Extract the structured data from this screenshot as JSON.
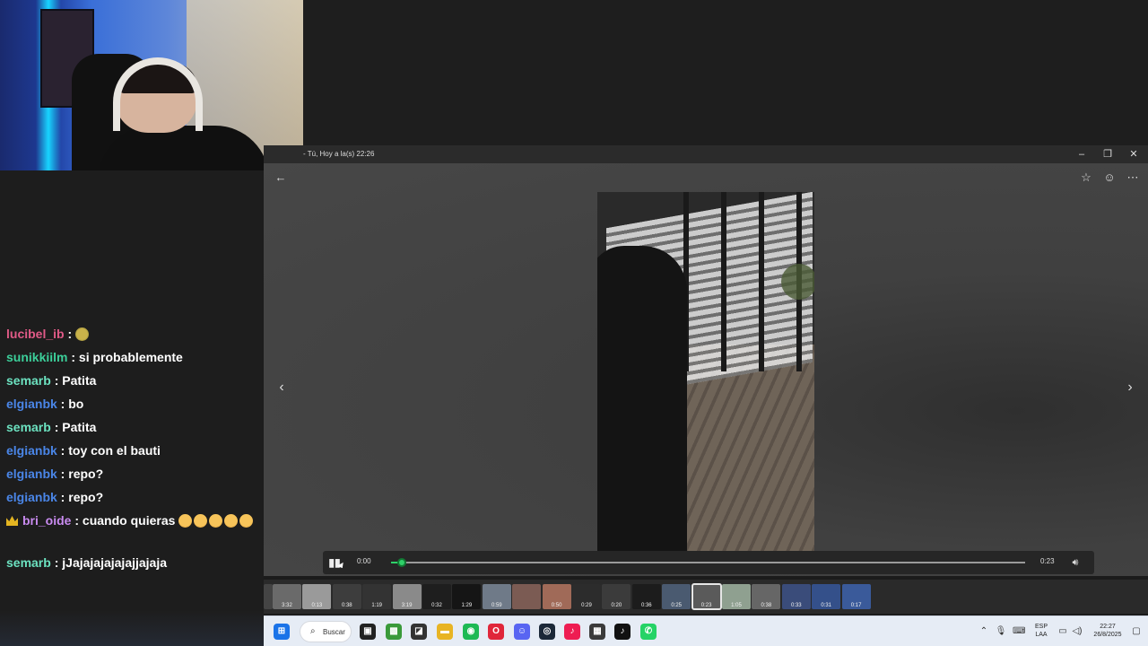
{
  "chat": {
    "messages": [
      {
        "user": "lucibel_ib",
        "user_color": "#e05a87",
        "text": "",
        "emote": "turtle"
      },
      {
        "user": "sunikkiilm",
        "user_color": "#3ccf9a",
        "text": "si probablemente"
      },
      {
        "user": "semarb",
        "user_color": "#6ce2c0",
        "text": "Patita"
      },
      {
        "user": "elgianbk",
        "user_color": "#4a86e8",
        "text": "bo"
      },
      {
        "user": "semarb",
        "user_color": "#6ce2c0",
        "text": "Patita"
      },
      {
        "user": "elgianbk",
        "user_color": "#4a86e8",
        "text": "toy con el bauti"
      },
      {
        "user": "elgianbk",
        "user_color": "#4a86e8",
        "text": "repo?"
      },
      {
        "user": "elgianbk",
        "user_color": "#4a86e8",
        "text": "repo?"
      },
      {
        "user": "bri_oide",
        "user_color": "#c98bf0",
        "text": "cuando quieras",
        "badge": "crown",
        "emotes": 5
      },
      {
        "user": "semarb",
        "user_color": "#6ce2c0",
        "text": "jJajajajajajajjajaja"
      }
    ]
  },
  "viewer": {
    "title": "- Tú, Hoy a la(s) 22:26",
    "current_time": "0:00",
    "duration": "0:23",
    "progress": 0.017,
    "icons": {
      "back": "back-arrow-icon",
      "star": "star-icon",
      "emoji": "emoji-icon",
      "more": "more-icon",
      "prev": "chevron-left-icon",
      "next": "chevron-right-icon",
      "play": "pause-icon",
      "volume": "volume-icon"
    }
  },
  "thumbnails": [
    {
      "label": "",
      "color": "#444"
    },
    {
      "label": "3:32",
      "color": "#6a6a6a"
    },
    {
      "label": "0:13",
      "color": "#9a9a9a"
    },
    {
      "label": "0:38",
      "color": "#3d3d3d"
    },
    {
      "label": "1:19",
      "color": "#333"
    },
    {
      "label": "3:19",
      "color": "#8a8a8a"
    },
    {
      "label": "0:32",
      "color": "#1e1e1e"
    },
    {
      "label": "1:29",
      "color": "#151515"
    },
    {
      "label": "0:59",
      "color": "#6f7a88"
    },
    {
      "label": "",
      "color": "#7b5b53"
    },
    {
      "label": "0:50",
      "color": "#a06a58"
    },
    {
      "label": "0:29",
      "color": "#2c2c2c"
    },
    {
      "label": "0:20",
      "color": "#3b3b3b"
    },
    {
      "label": "0:36",
      "color": "#1c1c1c"
    },
    {
      "label": "0:25",
      "color": "#4a5a70"
    },
    {
      "label": "0:23",
      "color": "#5a5a5a",
      "selected": true
    },
    {
      "label": "1:05",
      "color": "#8fa090"
    },
    {
      "label": "0:38",
      "color": "#666"
    },
    {
      "label": "0:33",
      "color": "#3a4c7a"
    },
    {
      "label": "0:31",
      "color": "#34508a"
    },
    {
      "label": "0:17",
      "color": "#3a5a9a"
    }
  ],
  "taskbar": {
    "search_label": "Buscar",
    "lang_top": "ESP",
    "lang_bottom": "LAA",
    "time": "22:27",
    "date": "26/8/2025",
    "apps": [
      {
        "name": "windows-start-icon",
        "color": "#1a73e8",
        "glyph": "⊞"
      },
      {
        "name": "task-view-icon",
        "color": "#222",
        "glyph": "▣"
      },
      {
        "name": "minecraft-icon",
        "color": "#3a9a3a",
        "glyph": "▩"
      },
      {
        "name": "notes-icon",
        "color": "#333",
        "glyph": "◪"
      },
      {
        "name": "file-explorer-icon",
        "color": "#e8b423",
        "glyph": "▬"
      },
      {
        "name": "spotify-icon",
        "color": "#1db954",
        "glyph": "◉"
      },
      {
        "name": "opera-icon",
        "color": "#e0263a",
        "glyph": "O"
      },
      {
        "name": "discord-icon",
        "color": "#5865f2",
        "glyph": "☺"
      },
      {
        "name": "steam-icon",
        "color": "#1b2838",
        "glyph": "◎"
      },
      {
        "name": "tiktok-studio-icon",
        "color": "#ee1d52",
        "glyph": "♪"
      },
      {
        "name": "obs-icon",
        "color": "#3a3a3a",
        "glyph": "▦"
      },
      {
        "name": "tiktok-icon",
        "color": "#111",
        "glyph": "♪"
      },
      {
        "name": "whatsapp-icon",
        "color": "#25d366",
        "glyph": "✆"
      }
    ]
  }
}
